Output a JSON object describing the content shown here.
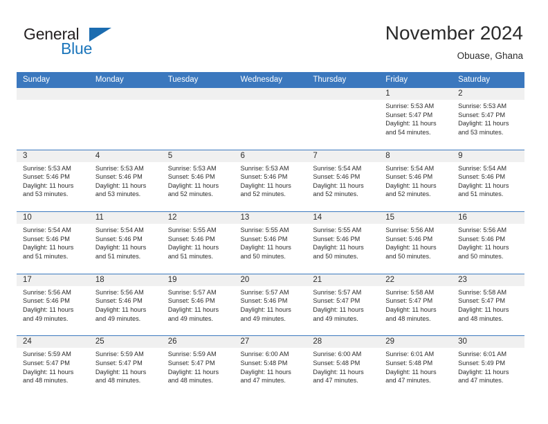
{
  "brand": {
    "name_part1": "General",
    "name_part2": "Blue",
    "logo_icon": "triangle-flag-icon"
  },
  "header": {
    "title": "November 2024",
    "location": "Obuase, Ghana"
  },
  "colors": {
    "header_blue": "#3b78be",
    "daynum_band": "#f0f0f0",
    "brand_blue": "#1b75bb",
    "text": "#2b2b2b"
  },
  "calendar": {
    "weekdays": [
      "Sunday",
      "Monday",
      "Tuesday",
      "Wednesday",
      "Thursday",
      "Friday",
      "Saturday"
    ],
    "weeks": [
      [
        {
          "day": "",
          "sunrise": "",
          "sunset": "",
          "daylight": "",
          "empty": true
        },
        {
          "day": "",
          "sunrise": "",
          "sunset": "",
          "daylight": "",
          "empty": true
        },
        {
          "day": "",
          "sunrise": "",
          "sunset": "",
          "daylight": "",
          "empty": true
        },
        {
          "day": "",
          "sunrise": "",
          "sunset": "",
          "daylight": "",
          "empty": true
        },
        {
          "day": "",
          "sunrise": "",
          "sunset": "",
          "daylight": "",
          "empty": true
        },
        {
          "day": "1",
          "sunrise": "Sunrise: 5:53 AM",
          "sunset": "Sunset: 5:47 PM",
          "daylight": "Daylight: 11 hours and 54 minutes."
        },
        {
          "day": "2",
          "sunrise": "Sunrise: 5:53 AM",
          "sunset": "Sunset: 5:47 PM",
          "daylight": "Daylight: 11 hours and 53 minutes."
        }
      ],
      [
        {
          "day": "3",
          "sunrise": "Sunrise: 5:53 AM",
          "sunset": "Sunset: 5:46 PM",
          "daylight": "Daylight: 11 hours and 53 minutes."
        },
        {
          "day": "4",
          "sunrise": "Sunrise: 5:53 AM",
          "sunset": "Sunset: 5:46 PM",
          "daylight": "Daylight: 11 hours and 53 minutes."
        },
        {
          "day": "5",
          "sunrise": "Sunrise: 5:53 AM",
          "sunset": "Sunset: 5:46 PM",
          "daylight": "Daylight: 11 hours and 52 minutes."
        },
        {
          "day": "6",
          "sunrise": "Sunrise: 5:53 AM",
          "sunset": "Sunset: 5:46 PM",
          "daylight": "Daylight: 11 hours and 52 minutes."
        },
        {
          "day": "7",
          "sunrise": "Sunrise: 5:54 AM",
          "sunset": "Sunset: 5:46 PM",
          "daylight": "Daylight: 11 hours and 52 minutes."
        },
        {
          "day": "8",
          "sunrise": "Sunrise: 5:54 AM",
          "sunset": "Sunset: 5:46 PM",
          "daylight": "Daylight: 11 hours and 52 minutes."
        },
        {
          "day": "9",
          "sunrise": "Sunrise: 5:54 AM",
          "sunset": "Sunset: 5:46 PM",
          "daylight": "Daylight: 11 hours and 51 minutes."
        }
      ],
      [
        {
          "day": "10",
          "sunrise": "Sunrise: 5:54 AM",
          "sunset": "Sunset: 5:46 PM",
          "daylight": "Daylight: 11 hours and 51 minutes."
        },
        {
          "day": "11",
          "sunrise": "Sunrise: 5:54 AM",
          "sunset": "Sunset: 5:46 PM",
          "daylight": "Daylight: 11 hours and 51 minutes."
        },
        {
          "day": "12",
          "sunrise": "Sunrise: 5:55 AM",
          "sunset": "Sunset: 5:46 PM",
          "daylight": "Daylight: 11 hours and 51 minutes."
        },
        {
          "day": "13",
          "sunrise": "Sunrise: 5:55 AM",
          "sunset": "Sunset: 5:46 PM",
          "daylight": "Daylight: 11 hours and 50 minutes."
        },
        {
          "day": "14",
          "sunrise": "Sunrise: 5:55 AM",
          "sunset": "Sunset: 5:46 PM",
          "daylight": "Daylight: 11 hours and 50 minutes."
        },
        {
          "day": "15",
          "sunrise": "Sunrise: 5:56 AM",
          "sunset": "Sunset: 5:46 PM",
          "daylight": "Daylight: 11 hours and 50 minutes."
        },
        {
          "day": "16",
          "sunrise": "Sunrise: 5:56 AM",
          "sunset": "Sunset: 5:46 PM",
          "daylight": "Daylight: 11 hours and 50 minutes."
        }
      ],
      [
        {
          "day": "17",
          "sunrise": "Sunrise: 5:56 AM",
          "sunset": "Sunset: 5:46 PM",
          "daylight": "Daylight: 11 hours and 49 minutes."
        },
        {
          "day": "18",
          "sunrise": "Sunrise: 5:56 AM",
          "sunset": "Sunset: 5:46 PM",
          "daylight": "Daylight: 11 hours and 49 minutes."
        },
        {
          "day": "19",
          "sunrise": "Sunrise: 5:57 AM",
          "sunset": "Sunset: 5:46 PM",
          "daylight": "Daylight: 11 hours and 49 minutes."
        },
        {
          "day": "20",
          "sunrise": "Sunrise: 5:57 AM",
          "sunset": "Sunset: 5:46 PM",
          "daylight": "Daylight: 11 hours and 49 minutes."
        },
        {
          "day": "21",
          "sunrise": "Sunrise: 5:57 AM",
          "sunset": "Sunset: 5:47 PM",
          "daylight": "Daylight: 11 hours and 49 minutes."
        },
        {
          "day": "22",
          "sunrise": "Sunrise: 5:58 AM",
          "sunset": "Sunset: 5:47 PM",
          "daylight": "Daylight: 11 hours and 48 minutes."
        },
        {
          "day": "23",
          "sunrise": "Sunrise: 5:58 AM",
          "sunset": "Sunset: 5:47 PM",
          "daylight": "Daylight: 11 hours and 48 minutes."
        }
      ],
      [
        {
          "day": "24",
          "sunrise": "Sunrise: 5:59 AM",
          "sunset": "Sunset: 5:47 PM",
          "daylight": "Daylight: 11 hours and 48 minutes."
        },
        {
          "day": "25",
          "sunrise": "Sunrise: 5:59 AM",
          "sunset": "Sunset: 5:47 PM",
          "daylight": "Daylight: 11 hours and 48 minutes."
        },
        {
          "day": "26",
          "sunrise": "Sunrise: 5:59 AM",
          "sunset": "Sunset: 5:47 PM",
          "daylight": "Daylight: 11 hours and 48 minutes."
        },
        {
          "day": "27",
          "sunrise": "Sunrise: 6:00 AM",
          "sunset": "Sunset: 5:48 PM",
          "daylight": "Daylight: 11 hours and 47 minutes."
        },
        {
          "day": "28",
          "sunrise": "Sunrise: 6:00 AM",
          "sunset": "Sunset: 5:48 PM",
          "daylight": "Daylight: 11 hours and 47 minutes."
        },
        {
          "day": "29",
          "sunrise": "Sunrise: 6:01 AM",
          "sunset": "Sunset: 5:48 PM",
          "daylight": "Daylight: 11 hours and 47 minutes."
        },
        {
          "day": "30",
          "sunrise": "Sunrise: 6:01 AM",
          "sunset": "Sunset: 5:49 PM",
          "daylight": "Daylight: 11 hours and 47 minutes."
        }
      ]
    ]
  }
}
